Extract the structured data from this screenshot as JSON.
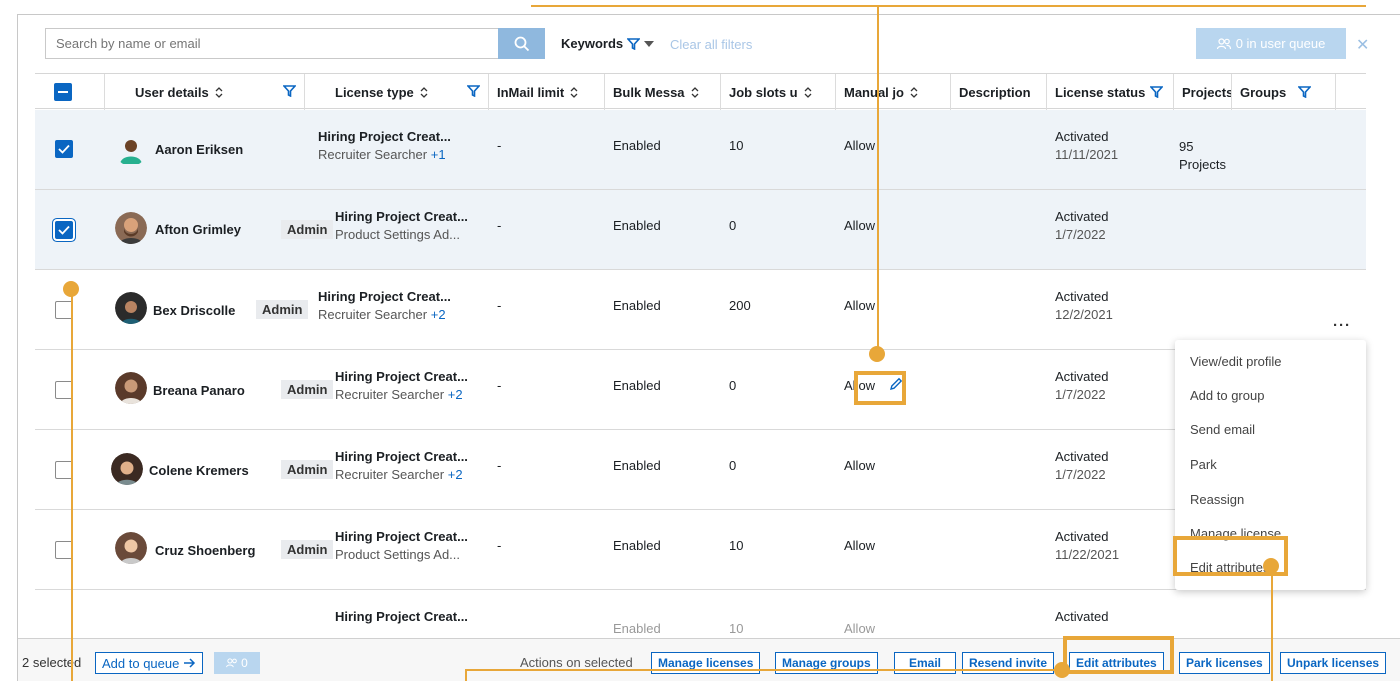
{
  "toolbar": {
    "search_placeholder": "Search by name or email",
    "keywords_label": "Keywords",
    "clear_filters": "Clear all filters",
    "queue_label": "0 in user queue"
  },
  "columns": [
    "User details",
    "License type",
    "InMail limit",
    "Bulk Messa",
    "Job slots u",
    "Manual jo",
    "Description",
    "License status",
    "Projects",
    "Groups"
  ],
  "rows": [
    {
      "name": "Aaron Eriksen",
      "admin": "",
      "license1": "Hiring Project Creat...",
      "license2": "Recruiter Searcher",
      "more": "+1",
      "inmail": "-",
      "bulk": "Enabled",
      "jobslots": "10",
      "manual": "Allow",
      "status": "Activated",
      "date": "11/11/2021",
      "projects": "95",
      "projects_label": "Projects",
      "checked": true
    },
    {
      "name": "Afton Grimley",
      "admin": "Admin",
      "license1": "Hiring Project Creat...",
      "license2": "Product Settings Ad...",
      "more": "",
      "inmail": "-",
      "bulk": "Enabled",
      "jobslots": "0",
      "manual": "Allow",
      "status": "Activated",
      "date": "1/7/2022",
      "projects": "",
      "projects_label": "",
      "checked": true
    },
    {
      "name": "Bex Driscolle",
      "admin": "Admin",
      "license1": "Hiring Project Creat...",
      "license2": "Recruiter Searcher",
      "more": "+2",
      "inmail": "-",
      "bulk": "Enabled",
      "jobslots": "200",
      "manual": "Allow",
      "status": "Activated",
      "date": "12/2/2021",
      "projects": "",
      "projects_label": "",
      "checked": false
    },
    {
      "name": "Breana Panaro",
      "admin": "Admin",
      "license1": "Hiring Project Creat...",
      "license2": "Recruiter Searcher",
      "more": "+2",
      "inmail": "-",
      "bulk": "Enabled",
      "jobslots": "0",
      "manual": "Allow",
      "status": "Activated",
      "date": "1/7/2022",
      "projects": "",
      "projects_label": "",
      "checked": false
    },
    {
      "name": "Colene Kremers",
      "admin": "Admin",
      "license1": "Hiring Project Creat...",
      "license2": "Recruiter Searcher",
      "more": "+2",
      "inmail": "-",
      "bulk": "Enabled",
      "jobslots": "0",
      "manual": "Allow",
      "status": "Activated",
      "date": "1/7/2022",
      "projects": "",
      "projects_label": "",
      "checked": false
    },
    {
      "name": "Cruz Shoenberg",
      "admin": "Admin",
      "license1": "Hiring Project Creat...",
      "license2": "Product Settings Ad...",
      "more": "",
      "inmail": "-",
      "bulk": "Enabled",
      "jobslots": "10",
      "manual": "Allow",
      "status": "Activated",
      "date": "11/22/2021",
      "projects": "",
      "projects_label": "",
      "checked": false
    },
    {
      "name": "",
      "admin": "",
      "license1": "Hiring Project Creat...",
      "license2": "",
      "more": "",
      "inmail": "",
      "bulk": "Enabled",
      "jobslots": "10",
      "manual": "Allow",
      "status": "Activated",
      "date": "",
      "projects": "",
      "projects_label": "",
      "checked": false
    }
  ],
  "menu": {
    "items": [
      "View/edit profile",
      "Add to group",
      "Send email",
      "Park",
      "Reassign",
      "Manage license",
      "Edit attributes"
    ]
  },
  "bottom": {
    "selected": "2 selected",
    "add_to_queue": "Add to queue",
    "queue_count": "0",
    "actions_label": "Actions on selected",
    "buttons": [
      "Manage licenses",
      "Manage groups",
      "Email",
      "Resend invite",
      "Edit attributes",
      "Park licenses",
      "Unpark licenses"
    ]
  },
  "colors": {
    "accent": "#0a66c2",
    "highlight": "#e8a739",
    "selected_row": "#eef3f8"
  }
}
